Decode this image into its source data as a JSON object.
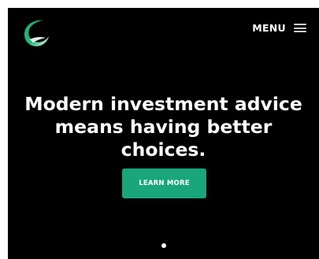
{
  "header": {
    "logo_icon": "crescent-swoosh-logo-icon",
    "menu_label": "MENU",
    "menu_icon": "hamburger-menu-icon"
  },
  "hero": {
    "headline": "Modern investment advice means having better choices.",
    "cta_label": "LEARN MORE",
    "slides": {
      "count": 1,
      "active": 1
    }
  },
  "colors": {
    "background": "#000000",
    "accent": "#19a67a",
    "logo_gradient": [
      "#1fa86f",
      "#e8f5ee"
    ],
    "text": "#ffffff"
  }
}
